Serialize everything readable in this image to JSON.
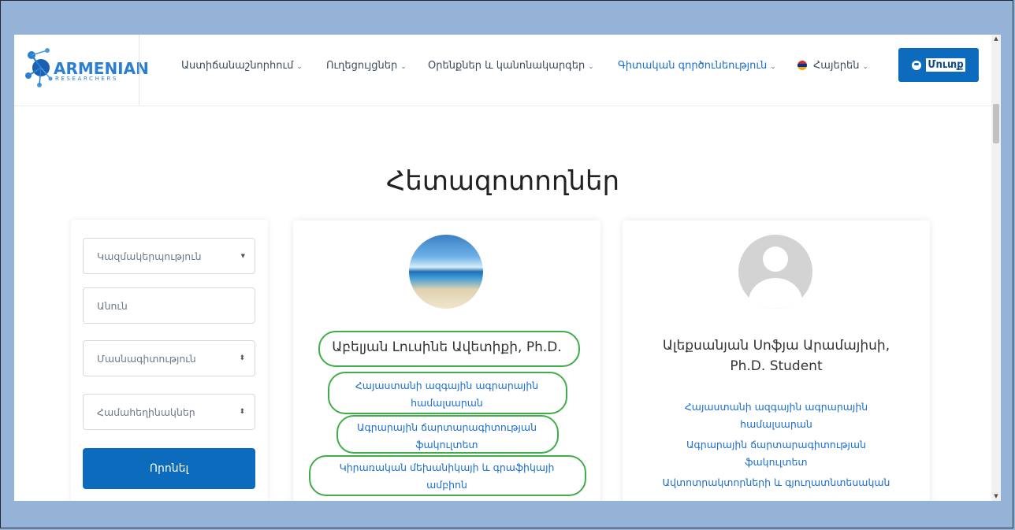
{
  "logo": {
    "main": "ARMENIAN",
    "sub": "RESEARCHERS"
  },
  "nav": {
    "items": [
      {
        "label": "Աստիճանաշնորհում"
      },
      {
        "label": "Ուղեցույցներ"
      },
      {
        "label": "Օրենքներ և կանոնակարգեր"
      },
      {
        "label": "Գիտական գործունեություն"
      }
    ],
    "language": "Հայերեն",
    "login": "Մուտք"
  },
  "page": {
    "title": "Հետազոտողներ"
  },
  "search": {
    "organization": "Կազմակերպություն",
    "name_placeholder": "Անուն",
    "specialty": "Մասնագիտություն",
    "keywords": "Համահեղինակներ",
    "button": "Որոնել"
  },
  "researchers": [
    {
      "name": "Աբելյան Լուսինե Ավետիքի, Ph.D.",
      "affiliations": [
        [
          "Հայաստանի ազգային ագրարային",
          "համալսարան"
        ],
        [
          "Ագրարային ճարտարագիտության",
          "ֆակուլտետ"
        ],
        [
          "Կիրառական մեխանիկայի և գրաֆիկայի",
          "ամբիոն"
        ]
      ]
    },
    {
      "name": [
        "Ալեքսանյան Սոֆյա Արամայիսի,",
        "Ph.D. Student"
      ],
      "affiliations": [
        [
          "Հայաստանի ազգային ագրարային",
          "համալսարան"
        ],
        [
          "Ագրարային ճարտարագիտության",
          "ֆակուլտետ"
        ],
        [
          "Ավտոտրակտորների և գյուղատնտեսական"
        ]
      ]
    }
  ],
  "colors": {
    "accent": "#0d6bbd",
    "link": "#1a6ed0",
    "highlight": "#3fae49",
    "backdrop": "#95b3d7"
  }
}
